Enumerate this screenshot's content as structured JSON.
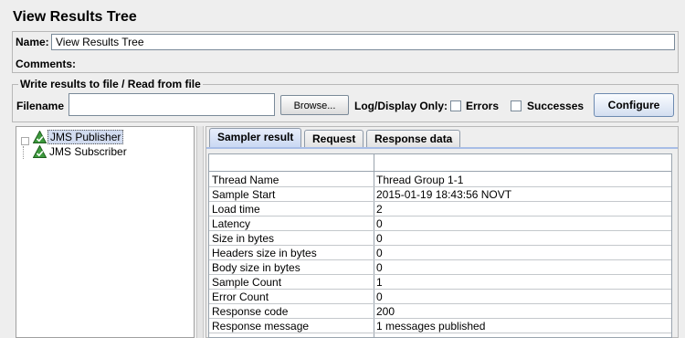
{
  "title": "View Results Tree",
  "name_label": "Name:",
  "name_value": "View Results Tree",
  "comments_label": "Comments:",
  "write_section": {
    "title": "Write results to file / Read from file",
    "filename_label": "Filename",
    "filename_value": "",
    "browse_label": "Browse...",
    "log_display_label": "Log/Display Only:",
    "errors_label": "Errors",
    "errors_checked": false,
    "successes_label": "Successes",
    "successes_checked": false,
    "configure_label": "Configure"
  },
  "tree": {
    "items": [
      {
        "label": "JMS Publisher",
        "selected": true,
        "icon": "success-sampler-icon"
      },
      {
        "label": "JMS Subscriber",
        "selected": false,
        "icon": "success-sampler-icon"
      }
    ]
  },
  "tabs": [
    "Sampler result",
    "Request",
    "Response data"
  ],
  "active_tab": "Sampler result",
  "sample_table": {
    "rows": [
      {
        "key": "Thread Name",
        "value": "Thread Group 1-1"
      },
      {
        "key": "Sample Start",
        "value": "2015-01-19 18:43:56 NOVT"
      },
      {
        "key": "Load time",
        "value": "2"
      },
      {
        "key": "Latency",
        "value": "0"
      },
      {
        "key": "Size in bytes",
        "value": "0"
      },
      {
        "key": "Headers size in bytes",
        "value": "0"
      },
      {
        "key": "Body size in bytes",
        "value": "0"
      },
      {
        "key": "Sample Count",
        "value": "1"
      },
      {
        "key": "Error Count",
        "value": "0"
      },
      {
        "key": "Response code",
        "value": "200"
      },
      {
        "key": "Response message",
        "value": "1 messages published"
      }
    ]
  }
}
